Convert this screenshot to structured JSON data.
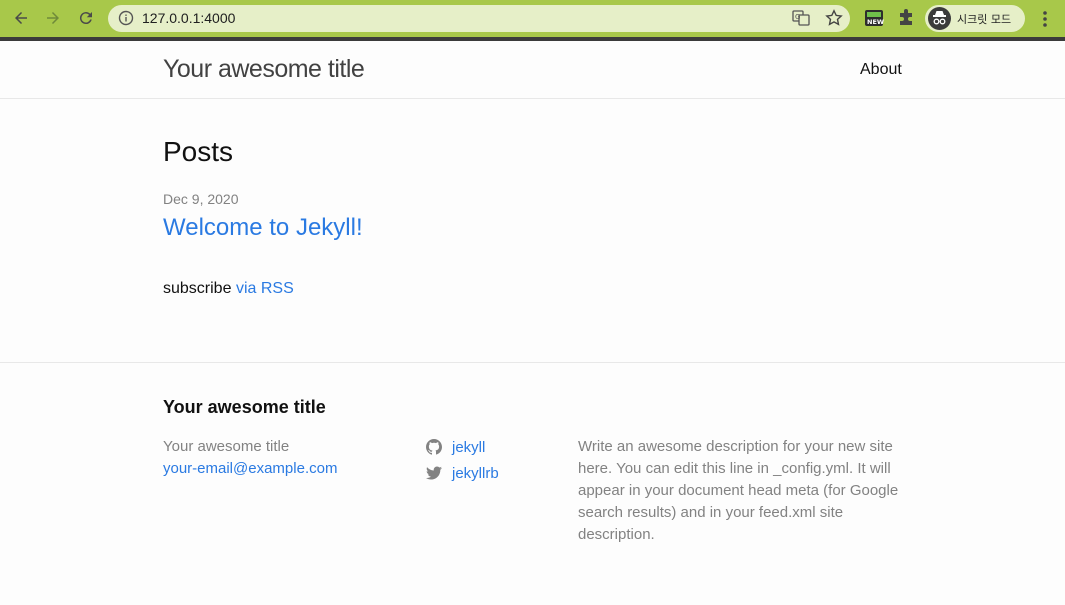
{
  "browser": {
    "url": "127.0.0.1:4000",
    "incognito_label": "시크릿 모드",
    "icons": [
      "back-icon",
      "forward-icon",
      "reload-icon",
      "info-icon",
      "translate-icon",
      "star-icon",
      "extension-new-icon",
      "puzzle-icon",
      "incognito-icon",
      "menu-icon"
    ],
    "colors": {
      "frame": "#a8c84a",
      "omnibox": "#e6efc8"
    }
  },
  "header": {
    "site_title": "Your awesome title",
    "nav": [
      {
        "label": "About"
      }
    ]
  },
  "main": {
    "heading": "Posts",
    "posts": [
      {
        "date": "Dec 9, 2020",
        "title": "Welcome to Jekyll!"
      }
    ],
    "subscribe_text": "subscribe",
    "subscribe_link": "via RSS"
  },
  "footer": {
    "heading": "Your awesome title",
    "name": "Your awesome title",
    "email": "your-email@example.com",
    "social": [
      {
        "icon": "github-icon",
        "label": "jekyll"
      },
      {
        "icon": "twitter-icon",
        "label": "jekyllrb"
      }
    ],
    "description": "Write an awesome description for your new site here. You can edit this line in _config.yml. It will appear in your document head meta (for Google search results) and in your feed.xml site description."
  },
  "colors": {
    "link": "#2a7ae2",
    "muted": "#828282",
    "text": "#111111"
  }
}
